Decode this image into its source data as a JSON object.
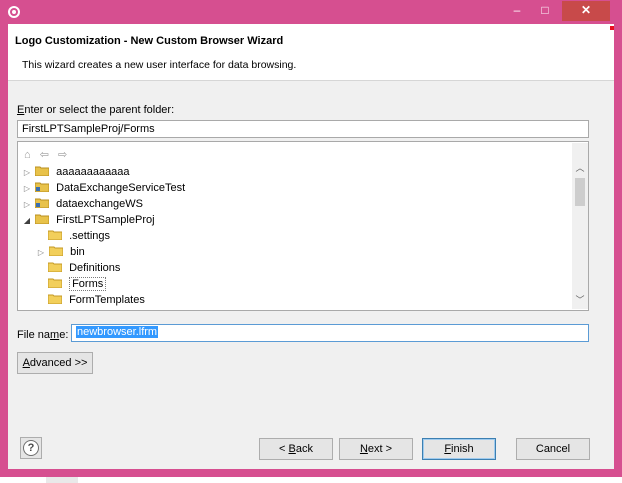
{
  "window": {
    "min_label": "–",
    "max_label": "□",
    "close_label": "✕"
  },
  "wizard": {
    "title": "Logo Customization - New Custom Browser Wizard",
    "description": "This wizard creates a new user interface for data browsing."
  },
  "parent_folder": {
    "label_pre": "",
    "label_u": "E",
    "label_post": "nter or select the parent folder:",
    "value": "FirstLPTSampleProj/Forms"
  },
  "tree": {
    "toolbar": "⌂ ⇦ ⇨",
    "items": [
      {
        "label": "aaaaaaaaaaaa",
        "expanded": false
      },
      {
        "label": "DataExchangeServiceTest",
        "expanded": false
      },
      {
        "label": "dataexchangeWS",
        "expanded": false
      },
      {
        "label": "FirstLPTSampleProj",
        "expanded": true
      },
      {
        "label": ".settings"
      },
      {
        "label": "bin",
        "expanded": false
      },
      {
        "label": "Definitions"
      },
      {
        "label": "Forms",
        "selected": true
      },
      {
        "label": "FormTemplates"
      }
    ]
  },
  "file_name": {
    "label_pre": "File na",
    "label_u": "m",
    "label_post": "e:",
    "value": "newbrowser.lfrm"
  },
  "advanced_button": {
    "label_u": "A",
    "label_post": "dvanced >>"
  },
  "footer": {
    "help": "?",
    "back": {
      "pre": "< ",
      "u": "B",
      "post": "ack"
    },
    "next": {
      "u": "N",
      "post": "ext >"
    },
    "finish": {
      "u": "F",
      "post": "inish"
    },
    "cancel": "Cancel"
  },
  "colors": {
    "frame": "#d64f90",
    "close": "#c84a4a",
    "selection": "#3399ff"
  }
}
